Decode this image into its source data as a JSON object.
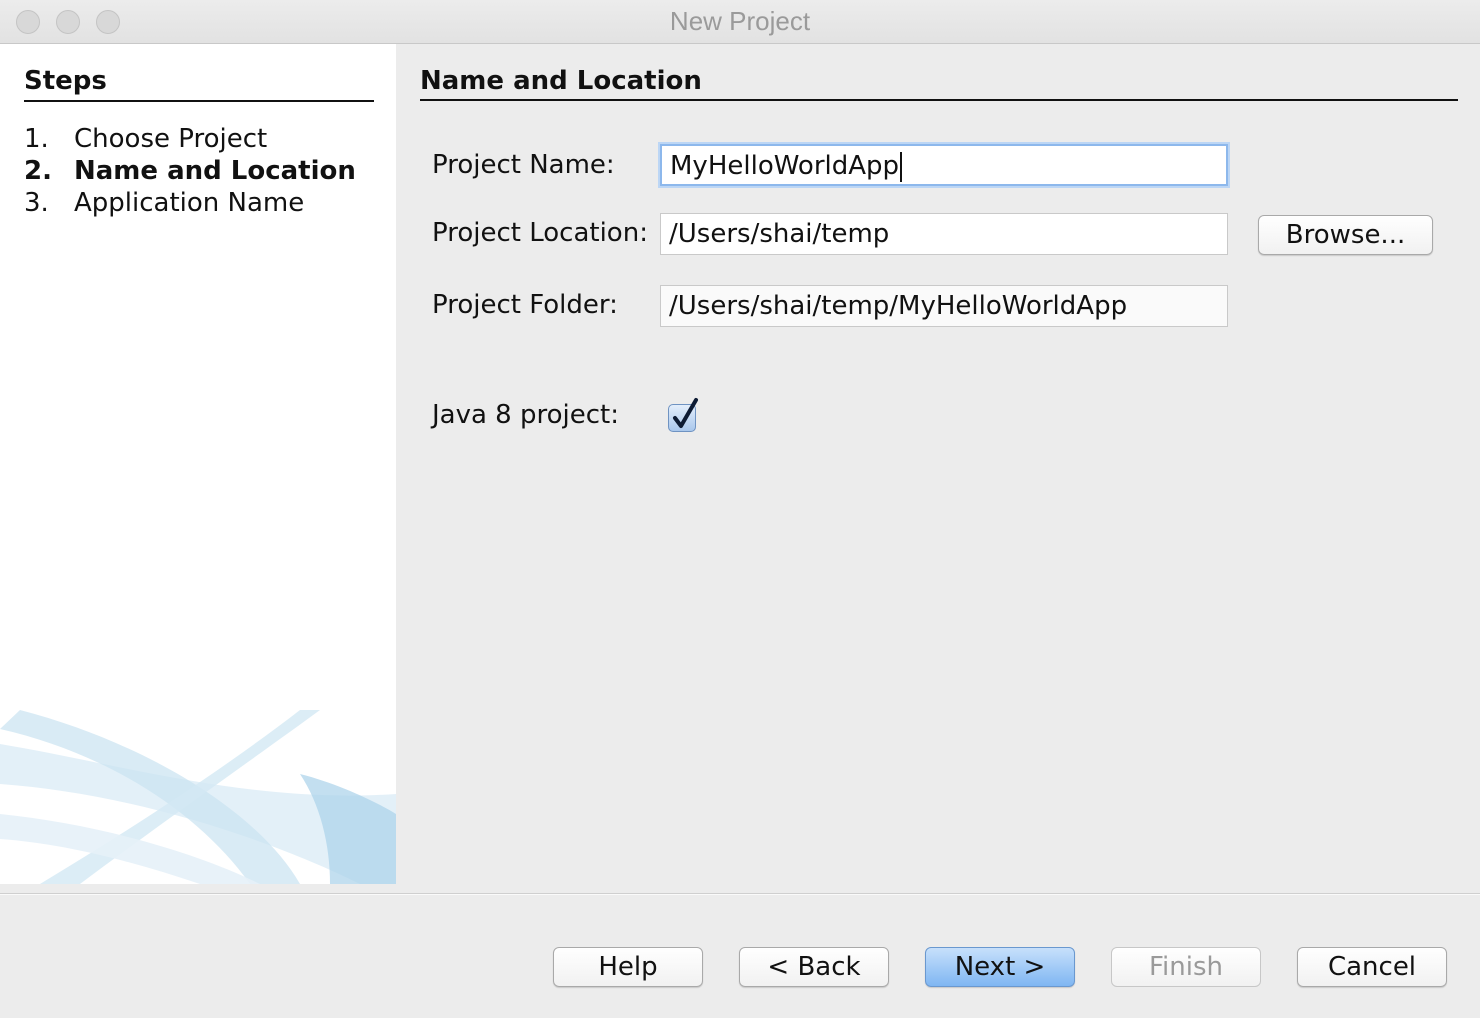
{
  "window": {
    "title": "New Project"
  },
  "steps": {
    "title": "Steps",
    "items": [
      {
        "num": "1.",
        "label": "Choose Project"
      },
      {
        "num": "2.",
        "label": "Name and Location"
      },
      {
        "num": "3.",
        "label": "Application Name"
      }
    ],
    "current_index": 1
  },
  "panel": {
    "title": "Name and Location",
    "project_name": {
      "label": "Project Name:",
      "value": "MyHelloWorldApp"
    },
    "project_location": {
      "label": "Project Location:",
      "value": "/Users/shai/temp"
    },
    "project_folder": {
      "label": "Project Folder:",
      "value": "/Users/shai/temp/MyHelloWorldApp"
    },
    "browse_label": "Browse...",
    "java8": {
      "label": "Java 8 project:",
      "checked": true
    }
  },
  "buttons": {
    "help": "Help",
    "back": "< Back",
    "next": "Next >",
    "finish": "Finish",
    "cancel": "Cancel"
  },
  "colors": {
    "accent": "#7fb6f2",
    "focus_ring": "#8db8ec"
  }
}
